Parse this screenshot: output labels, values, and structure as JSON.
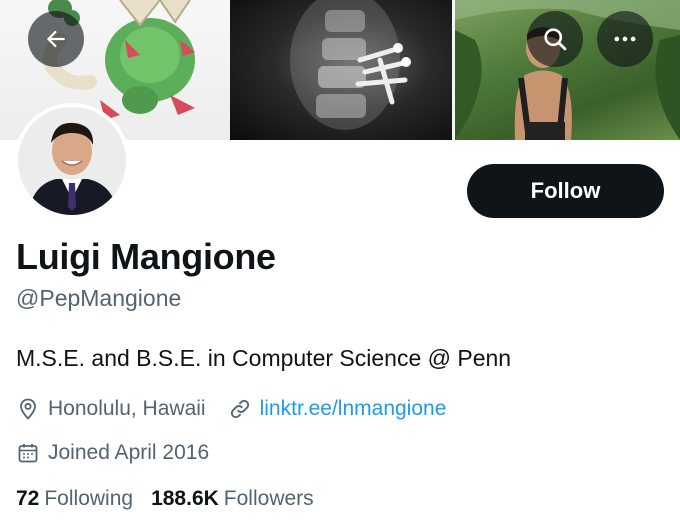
{
  "header": {
    "back_icon": "arrow-left-icon",
    "search_icon": "search-icon",
    "more_icon": "more-dots-icon"
  },
  "profile": {
    "name": "Luigi Mangione",
    "handle": "@PepMangione",
    "bio": "M.S.E. and B.S.E. in Computer Science @ Penn",
    "location": "Honolulu, Hawaii",
    "website": "linktr.ee/lnmangione",
    "joined": "Joined April 2016"
  },
  "actions": {
    "follow_label": "Follow"
  },
  "stats": {
    "following_count": "72",
    "following_label": "Following",
    "followers_count": "188.6K",
    "followers_label": "Followers"
  },
  "colors": {
    "link": "#1d9bf0",
    "secondary_text": "#536471",
    "primary_text": "#0f1419",
    "button_bg": "#0f1419"
  }
}
